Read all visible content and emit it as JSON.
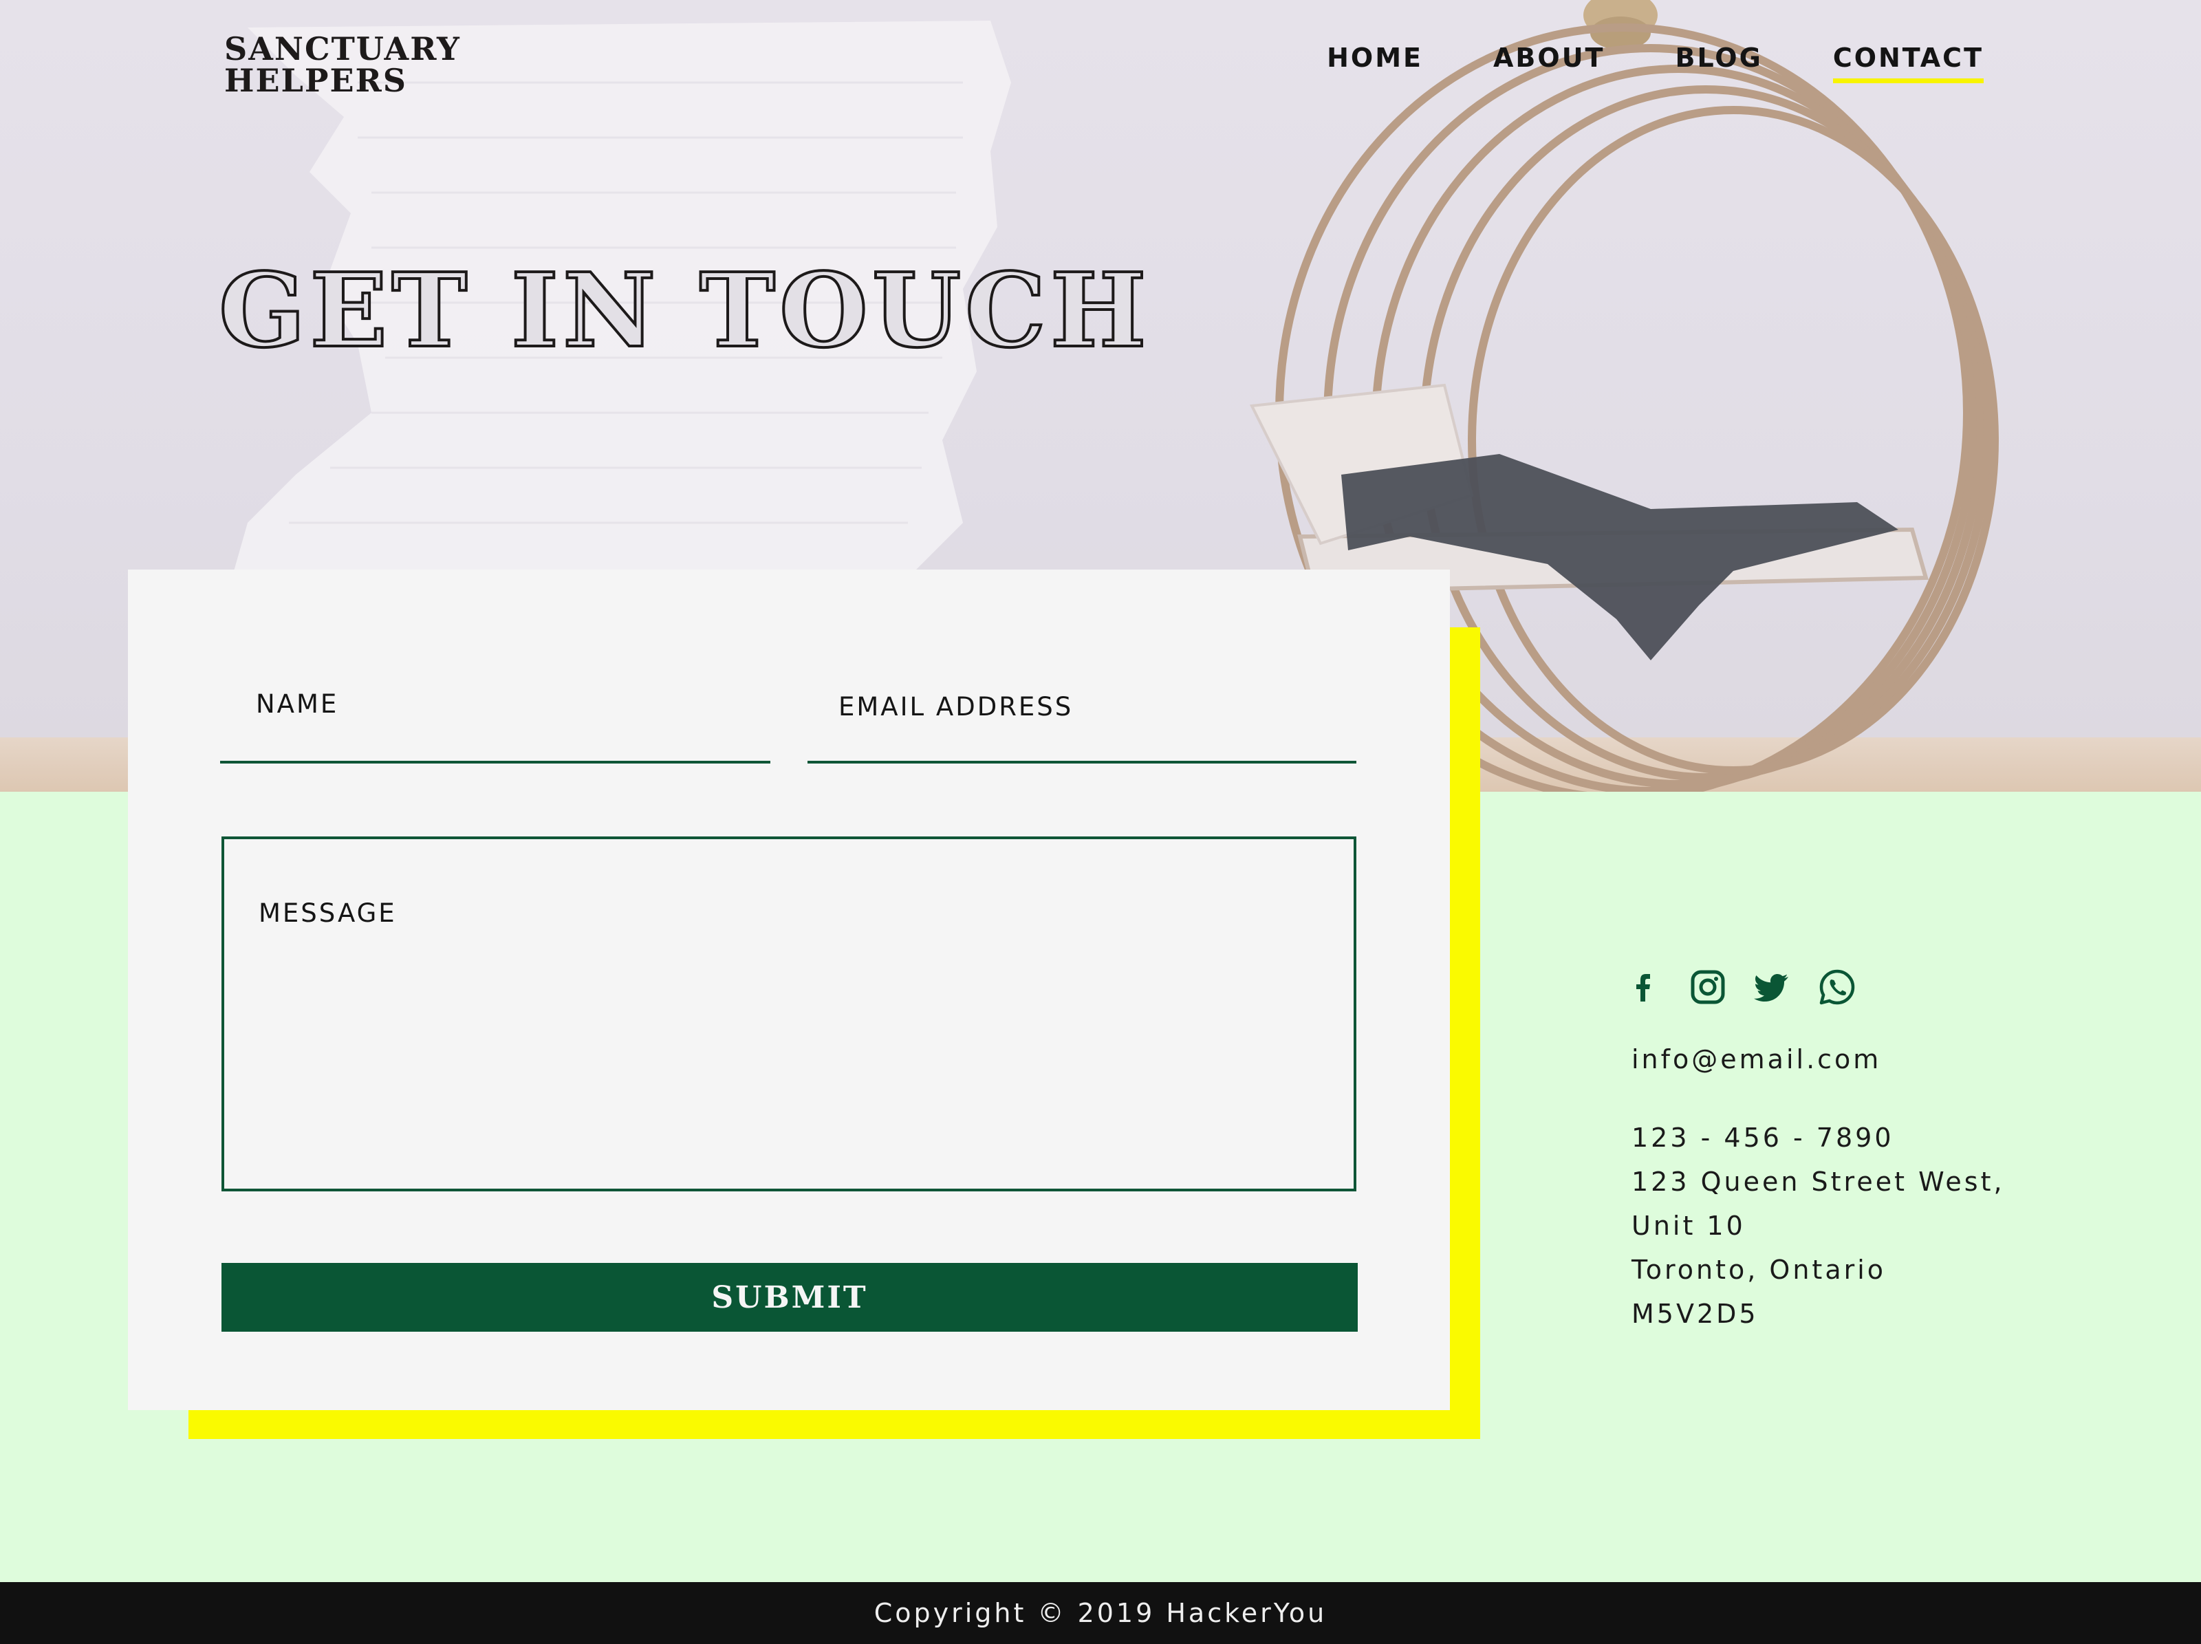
{
  "brand": {
    "line1": "SANCTUARY",
    "line2": "HELPERS"
  },
  "nav": {
    "items": [
      {
        "label": "HOME",
        "active": false
      },
      {
        "label": "ABOUT",
        "active": false
      },
      {
        "label": "BLOG",
        "active": false
      },
      {
        "label": "CONTACT",
        "active": true
      }
    ]
  },
  "hero": {
    "headline": "GET IN TOUCH"
  },
  "form": {
    "name_label": "NAME",
    "email_label": "EMAIL ADDRESS",
    "message_label": "MESSAGE",
    "submit_label": "SUBMIT"
  },
  "contact": {
    "social_icons": [
      "facebook-icon",
      "instagram-icon",
      "twitter-icon",
      "whatsapp-icon"
    ],
    "email": "info@email.com",
    "phone": "123 - 456 - 7890",
    "address_line1": "123 Queen Street West,",
    "address_line2": "Unit 10",
    "address_line3": "Toronto, Ontario",
    "address_line4": "M5V2D5"
  },
  "footer": {
    "copyright": "Copyright © 2019 HackerYou"
  },
  "colors": {
    "brand_green": "#0a5635",
    "accent_yellow": "#fafa00",
    "mint_background": "#defcdc",
    "card_background": "#f5f5f5",
    "footer_background": "#111111"
  }
}
